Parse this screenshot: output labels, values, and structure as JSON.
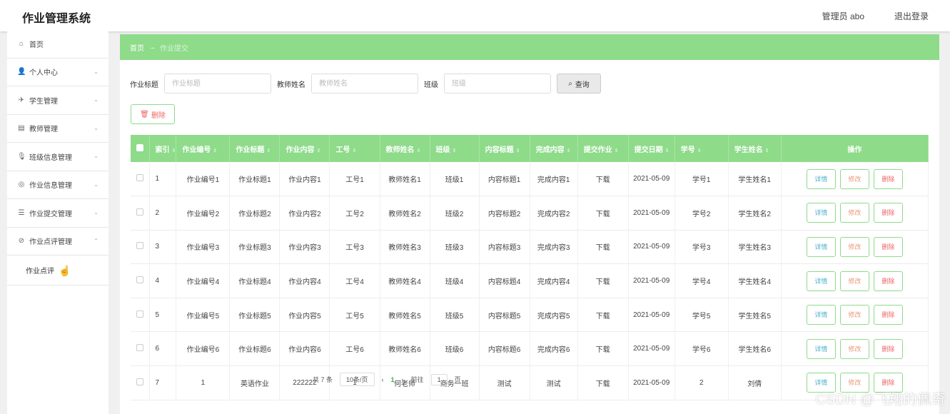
{
  "header": {
    "title": "作业管理系统",
    "user": "管理员 abo",
    "logout": "退出登录"
  },
  "sidebar": {
    "items": [
      {
        "label": "首页",
        "icon": "home-icon",
        "glyph": "⌂",
        "arrow": ""
      },
      {
        "label": "个人中心",
        "icon": "person-icon",
        "glyph": "👤",
        "arrow": "⌄"
      },
      {
        "label": "学生管理",
        "icon": "send-icon",
        "glyph": "✈",
        "arrow": "⌄"
      },
      {
        "label": "教师管理",
        "icon": "clipboard-icon",
        "glyph": "▤",
        "arrow": "⌄"
      },
      {
        "label": "班级信息管理",
        "icon": "microphone-icon",
        "glyph": "🎙",
        "arrow": "⌄"
      },
      {
        "label": "作业信息管理",
        "icon": "settings-icon",
        "glyph": "◎",
        "arrow": "⌄"
      },
      {
        "label": "作业提交管理",
        "icon": "sliders-icon",
        "glyph": "☰",
        "arrow": "⌄"
      },
      {
        "label": "作业点评管理",
        "icon": "no-entry-icon",
        "glyph": "⊘",
        "arrow": "⌃"
      }
    ],
    "sub_item": "作业点评"
  },
  "breadcrumb": {
    "home": "首页",
    "separator": "→",
    "current": "作业提交"
  },
  "search": {
    "title_label": "作业标题",
    "title_placeholder": "作业标题",
    "teacher_label": "教师姓名",
    "teacher_placeholder": "教师姓名",
    "class_label": "班级",
    "class_placeholder": "班级",
    "query_button": "查询"
  },
  "delete_button": "删除",
  "table": {
    "headers": [
      "索引",
      "作业编号",
      "作业标题",
      "作业内容",
      "工号",
      "教师姓名",
      "班级",
      "内容标题",
      "完成内容",
      "提交作业",
      "提交日期",
      "学号",
      "学生姓名",
      "操作"
    ],
    "download_label": "下载",
    "op_labels": {
      "detail": "详情",
      "edit": "修改",
      "delete": "删除"
    },
    "rows": [
      [
        "1",
        "作业编号1",
        "作业标题1",
        "作业内容1",
        "工号1",
        "教师姓名1",
        "班级1",
        "内容标题1",
        "完成内容1",
        "2021-05-09",
        "学号1",
        "学生姓名1"
      ],
      [
        "2",
        "作业编号2",
        "作业标题2",
        "作业内容2",
        "工号2",
        "教师姓名2",
        "班级2",
        "内容标题2",
        "完成内容2",
        "2021-05-09",
        "学号2",
        "学生姓名2"
      ],
      [
        "3",
        "作业编号3",
        "作业标题3",
        "作业内容3",
        "工号3",
        "教师姓名3",
        "班级3",
        "内容标题3",
        "完成内容3",
        "2021-05-09",
        "学号3",
        "学生姓名3"
      ],
      [
        "4",
        "作业编号4",
        "作业标题4",
        "作业内容4",
        "工号4",
        "教师姓名4",
        "班级4",
        "内容标题4",
        "完成内容4",
        "2021-05-09",
        "学号4",
        "学生姓名4"
      ],
      [
        "5",
        "作业编号5",
        "作业标题5",
        "作业内容5",
        "工号5",
        "教师姓名5",
        "班级5",
        "内容标题5",
        "完成内容5",
        "2021-05-09",
        "学号5",
        "学生姓名5"
      ],
      [
        "6",
        "作业编号6",
        "作业标题6",
        "作业内容6",
        "工号6",
        "教师姓名6",
        "班级6",
        "内容标题6",
        "完成内容6",
        "2021-05-09",
        "学号6",
        "学生姓名6"
      ],
      [
        "7",
        "1",
        "英语作业",
        "222222",
        "1",
        "何老师",
        "商务一班",
        "测试",
        "测试",
        "2021-05-09",
        "2",
        "刘倩"
      ]
    ]
  },
  "pager": {
    "total": "共 7 条",
    "page_size": "10条/页",
    "prev": "‹",
    "current": "1",
    "next": "›",
    "goto_label": "前往",
    "goto_value": "1",
    "page_suffix": "页"
  },
  "watermark": "CSDN @飞翔的佩奇"
}
